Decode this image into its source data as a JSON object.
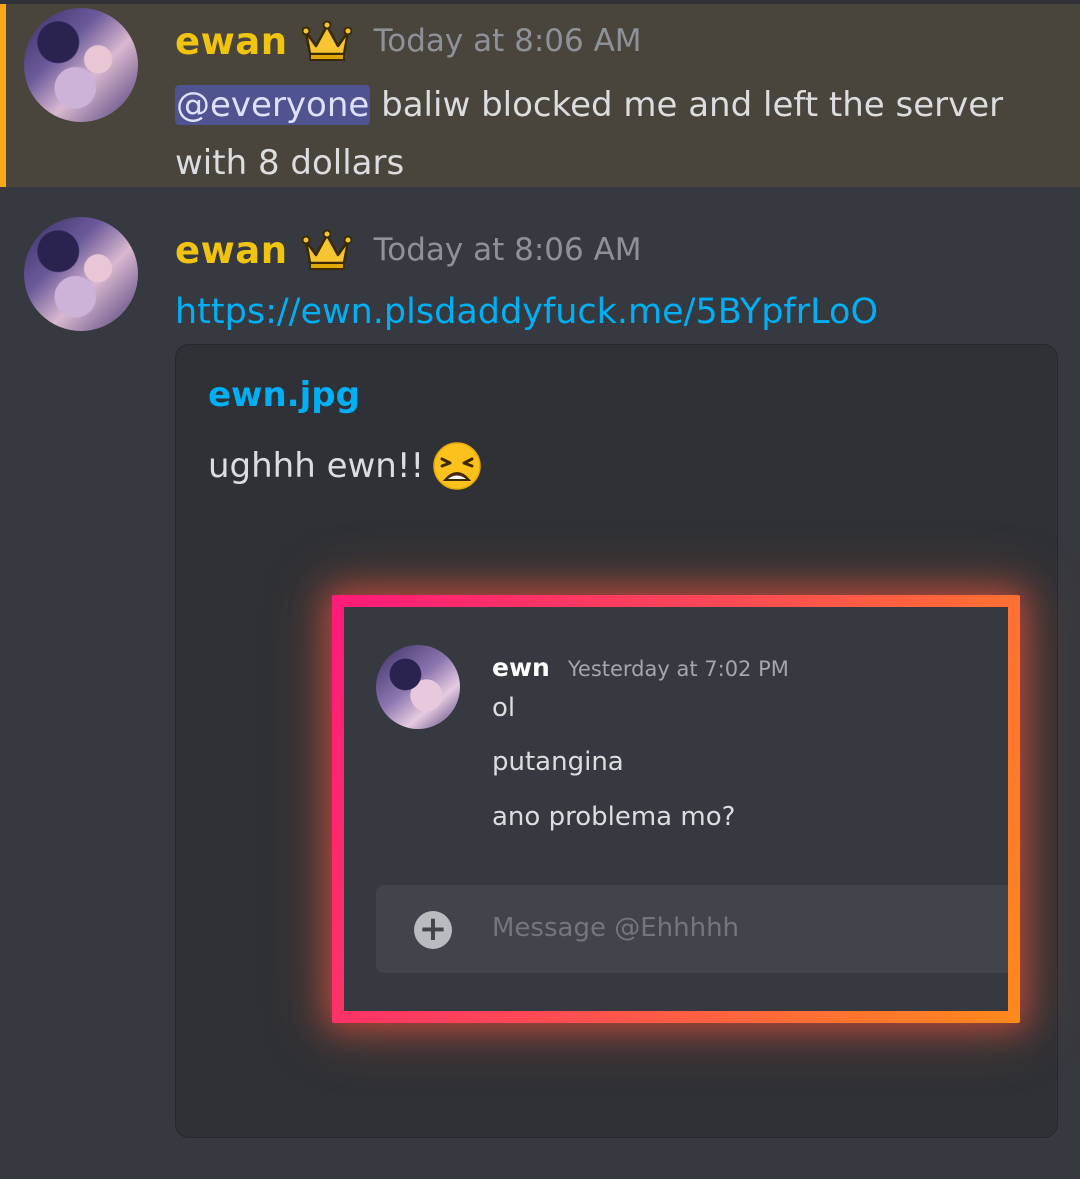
{
  "messages": [
    {
      "username": "ewan",
      "timestamp": "Today at 8:06 AM",
      "mention": "@everyone",
      "text_line1": "baliw blocked me and left the server",
      "text_line2": "with 8 dollars"
    },
    {
      "username": "ewan",
      "timestamp": "Today at 8:06 AM",
      "link": "https://ewn.plsdaddyfuck.me/5BYpfrLoO",
      "embed": {
        "title": "ewn.jpg",
        "description": "ughhh ewn!!",
        "emoji": "weary-face-emoji",
        "image": {
          "username": "ewn",
          "timestamp": "Yesterday at 7:02 PM",
          "lines": [
            "ol",
            "putangina",
            "ano problema mo?"
          ],
          "input_placeholder": "Message @Ehhhhh"
        }
      }
    }
  ],
  "colors": {
    "background": "#36393f",
    "mention_highlight": "#49443c",
    "mention_bar": "#faa81a",
    "username": "#f1c40f",
    "link": "#00aff4"
  }
}
